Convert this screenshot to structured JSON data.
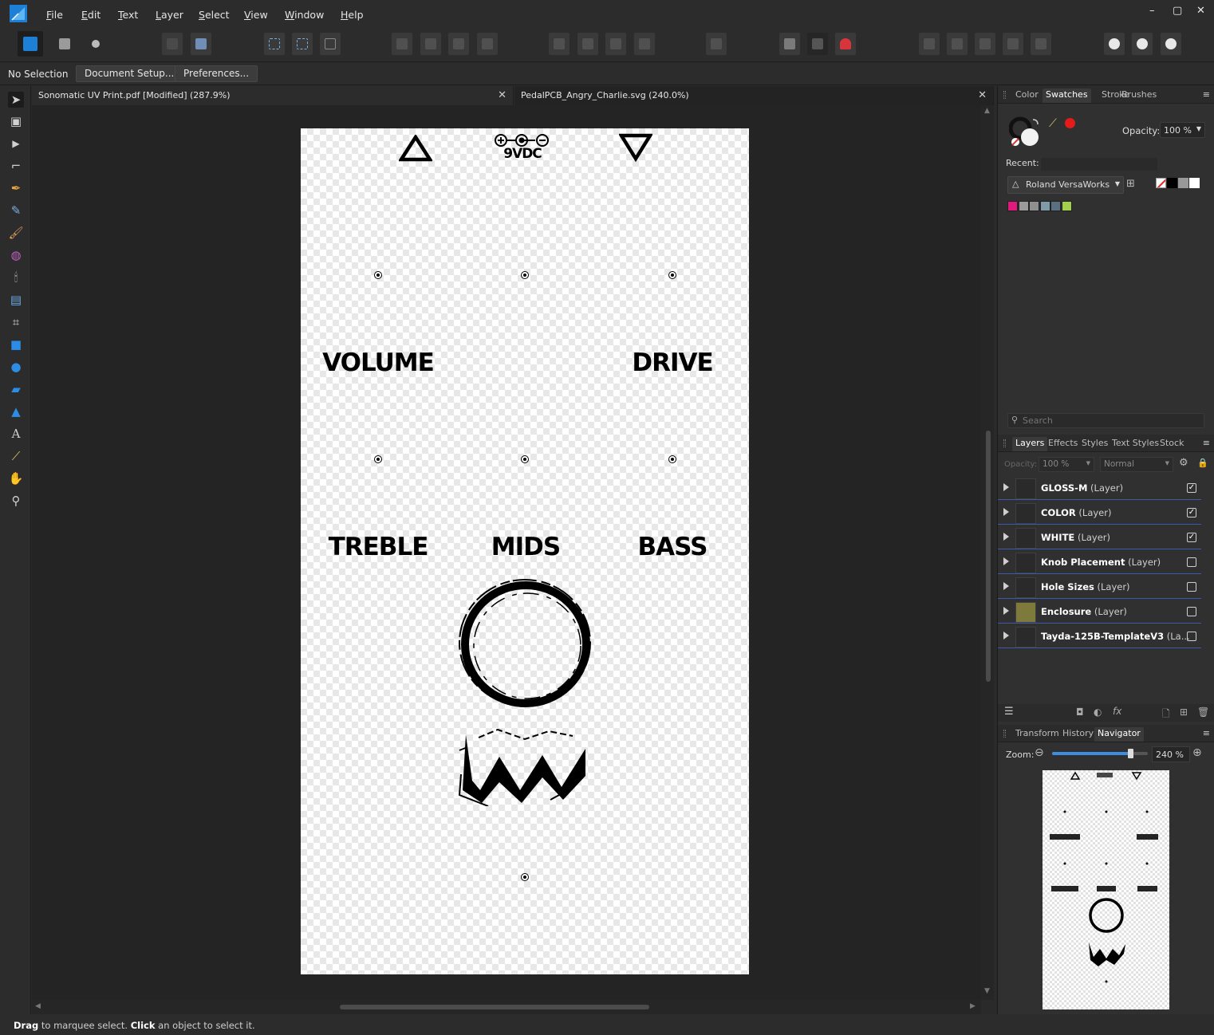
{
  "menubar": {
    "items": [
      "File",
      "Edit",
      "Text",
      "Layer",
      "Select",
      "View",
      "Window",
      "Help"
    ],
    "window_controls": [
      "–",
      "▢",
      "✕"
    ]
  },
  "context": {
    "selection": "No Selection",
    "document_setup": "Document Setup...",
    "preferences": "Preferences..."
  },
  "tabs": [
    {
      "title": "Sonomatic UV Print.pdf [Modified] (287.9%)",
      "close": "✕"
    },
    {
      "title": "PedalPCB_Angry_Charlie.svg (240.0%)",
      "close": "✕"
    }
  ],
  "artwork": {
    "dc_label": "9VDC",
    "labels": {
      "volume": "VOLUME",
      "drive": "DRIVE",
      "treble": "TREBLE",
      "mids": "MIDS",
      "bass": "BASS"
    }
  },
  "status": {
    "b1": "Drag",
    "t1": " to marquee select. ",
    "b2": "Click",
    "t2": " an object to select it."
  },
  "panel_top": {
    "tabs": [
      "Color",
      "Swatches",
      "Stroke",
      "Brushes"
    ],
    "active": "Swatches",
    "opacity_label": "Opacity:",
    "opacity_value": "100 %",
    "recent_label": "Recent:",
    "palette": "Roland VersaWorks",
    "swatch_colors": [
      "#e0197d",
      "#9a9a9a",
      "#8f8f8f",
      "#7f9aa8",
      "#5a6f80",
      "#a3cf4f"
    ],
    "search_placeholder": "Search"
  },
  "layers_panel": {
    "tabs": [
      "Layers",
      "Effects",
      "Styles",
      "Text Styles",
      "Stock"
    ],
    "active": "Layers",
    "opacity_label": "Opacity:",
    "opacity_value": "100 %",
    "blend": "Normal",
    "rows": [
      {
        "name": "GLOSS-M",
        "type": " (Layer)",
        "checked": "✓"
      },
      {
        "name": "COLOR",
        "type": " (Layer)",
        "checked": "✓"
      },
      {
        "name": "WHITE",
        "type": " (Layer)",
        "checked": "✓"
      },
      {
        "name": "Knob Placement",
        "type": " (Layer)",
        "checked": ""
      },
      {
        "name": "Hole Sizes",
        "type": " (Layer)",
        "checked": ""
      },
      {
        "name": "Enclosure",
        "type": " (Layer)",
        "checked": ""
      },
      {
        "name": "Tayda-125B-TemplateV3",
        "type": " (La...",
        "checked": ""
      }
    ]
  },
  "nav_panel": {
    "tabs": [
      "Transform",
      "History",
      "Navigator"
    ],
    "active": "Navigator",
    "zoom_label": "Zoom:",
    "zoom_value": "240 %",
    "zoom_level_pct": 82
  }
}
